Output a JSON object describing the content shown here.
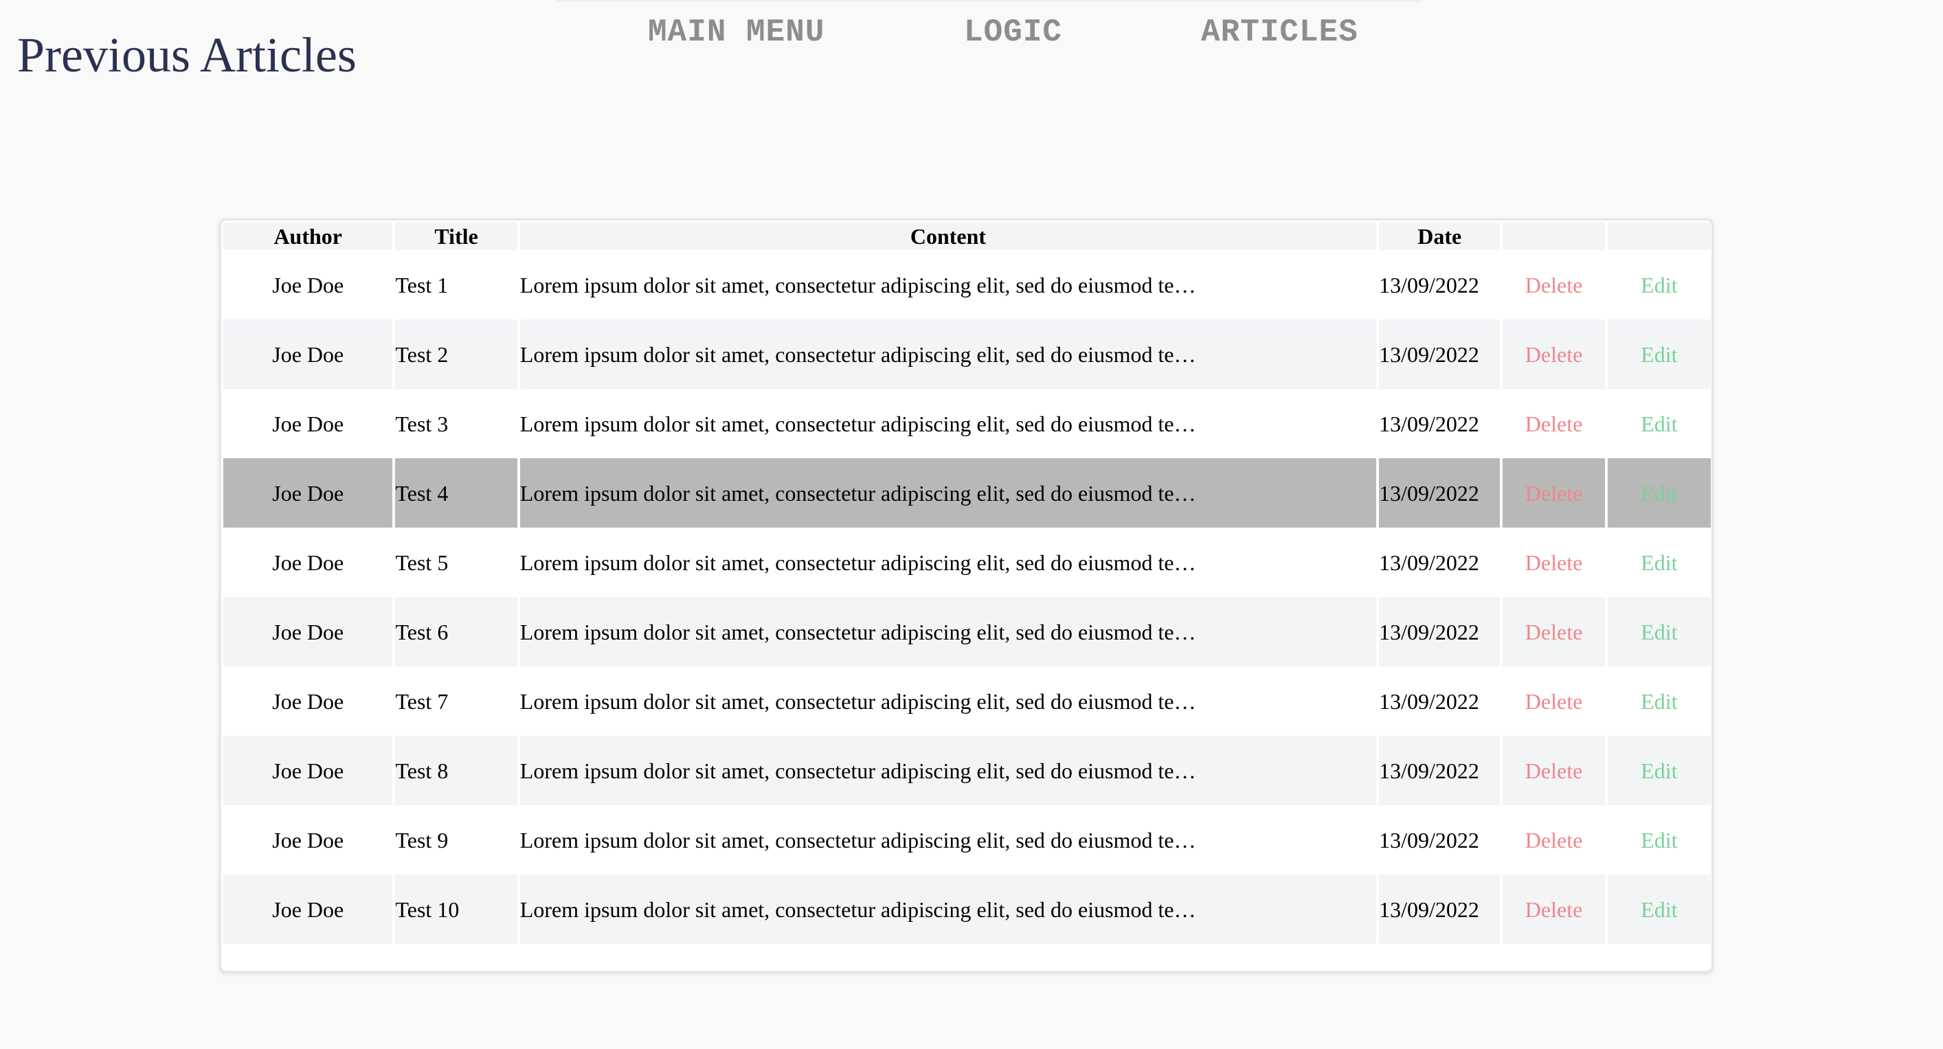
{
  "page": {
    "title": "Previous Articles"
  },
  "nav": {
    "items": [
      {
        "label": "MAIN MENU"
      },
      {
        "label": "LOGIC"
      },
      {
        "label": "ARTICLES"
      }
    ]
  },
  "table": {
    "columns": [
      "Author",
      "Title",
      "Content",
      "Date",
      "",
      ""
    ],
    "delete_label": "Delete",
    "edit_label": "Edit",
    "selected_row": 4,
    "rows": [
      {
        "author": "Joe Doe",
        "title": "Test 1",
        "content": "Lorem ipsum dolor sit amet, consectetur adipiscing elit, sed do eiusmod te…",
        "date": "13/09/2022"
      },
      {
        "author": "Joe Doe",
        "title": "Test 2",
        "content": "Lorem ipsum dolor sit amet, consectetur adipiscing elit, sed do eiusmod te…",
        "date": "13/09/2022"
      },
      {
        "author": "Joe Doe",
        "title": "Test 3",
        "content": "Lorem ipsum dolor sit amet, consectetur adipiscing elit, sed do eiusmod te…",
        "date": "13/09/2022"
      },
      {
        "author": "Joe Doe",
        "title": "Test 4",
        "content": "Lorem ipsum dolor sit amet, consectetur adipiscing elit, sed do eiusmod te…",
        "date": "13/09/2022"
      },
      {
        "author": "Joe Doe",
        "title": "Test 5",
        "content": "Lorem ipsum dolor sit amet, consectetur adipiscing elit, sed do eiusmod te…",
        "date": "13/09/2022"
      },
      {
        "author": "Joe Doe",
        "title": "Test 6",
        "content": "Lorem ipsum dolor sit amet, consectetur adipiscing elit, sed do eiusmod te…",
        "date": "13/09/2022"
      },
      {
        "author": "Joe Doe",
        "title": "Test 7",
        "content": "Lorem ipsum dolor sit amet, consectetur adipiscing elit, sed do eiusmod te…",
        "date": "13/09/2022"
      },
      {
        "author": "Joe Doe",
        "title": "Test 8",
        "content": "Lorem ipsum dolor sit amet, consectetur adipiscing elit, sed do eiusmod te…",
        "date": "13/09/2022"
      },
      {
        "author": "Joe Doe",
        "title": "Test 9",
        "content": "Lorem ipsum dolor sit amet, consectetur adipiscing elit, sed do eiusmod te…",
        "date": "13/09/2022"
      },
      {
        "author": "Joe Doe",
        "title": "Test 10",
        "content": "Lorem ipsum dolor sit amet, consectetur adipiscing elit, sed do eiusmod te…",
        "date": "13/09/2022"
      }
    ]
  },
  "colors": {
    "title": "#2b3250",
    "nav": "#8d8d8d",
    "delete": "#f0868a",
    "edit": "#76d39a",
    "row_alt": "#f3f4f6",
    "row_selected": "#b8b8b7"
  }
}
